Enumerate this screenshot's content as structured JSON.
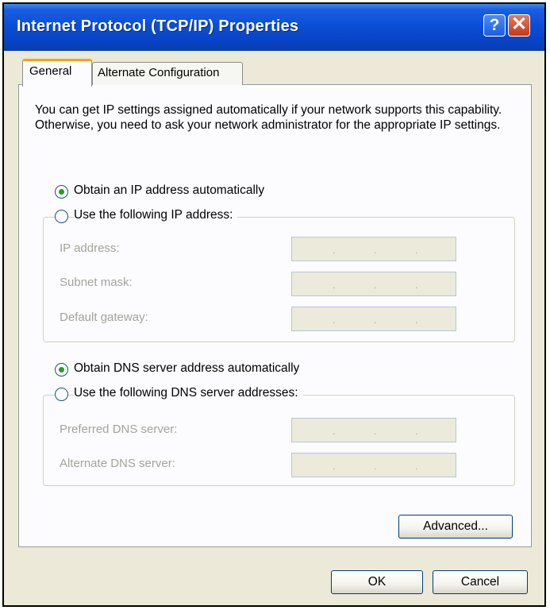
{
  "window": {
    "title": "Internet Protocol (TCP/IP) Properties"
  },
  "titlebar": {
    "help_glyph": "?",
    "close_glyph": "✕"
  },
  "tabs": [
    {
      "label": "General"
    },
    {
      "label": "Alternate Configuration"
    }
  ],
  "general": {
    "description": "You can get IP settings assigned automatically if your network supports this capability. Otherwise, you need to ask your network administrator for the appropriate IP settings.",
    "ip": {
      "auto_label": "Obtain an IP address automatically",
      "manual_label": "Use the following IP address:",
      "selected": "auto",
      "fields": [
        {
          "label": "IP address:",
          "value": ""
        },
        {
          "label": "Subnet mask:",
          "value": ""
        },
        {
          "label": "Default gateway:",
          "value": ""
        }
      ]
    },
    "dns": {
      "auto_label": "Obtain DNS server address automatically",
      "manual_label": "Use the following DNS server addresses:",
      "selected": "auto",
      "fields": [
        {
          "label": "Preferred DNS server:",
          "value": ""
        },
        {
          "label": "Alternate DNS server:",
          "value": ""
        }
      ]
    },
    "advanced_label": "Advanced..."
  },
  "footer": {
    "ok_label": "OK",
    "cancel_label": "Cancel"
  },
  "colors": {
    "titlebar": "#0a4fd8",
    "radio_dot": "#21a121",
    "tab_highlight": "#f5a21d",
    "disabled_text": "#a3a39a"
  }
}
